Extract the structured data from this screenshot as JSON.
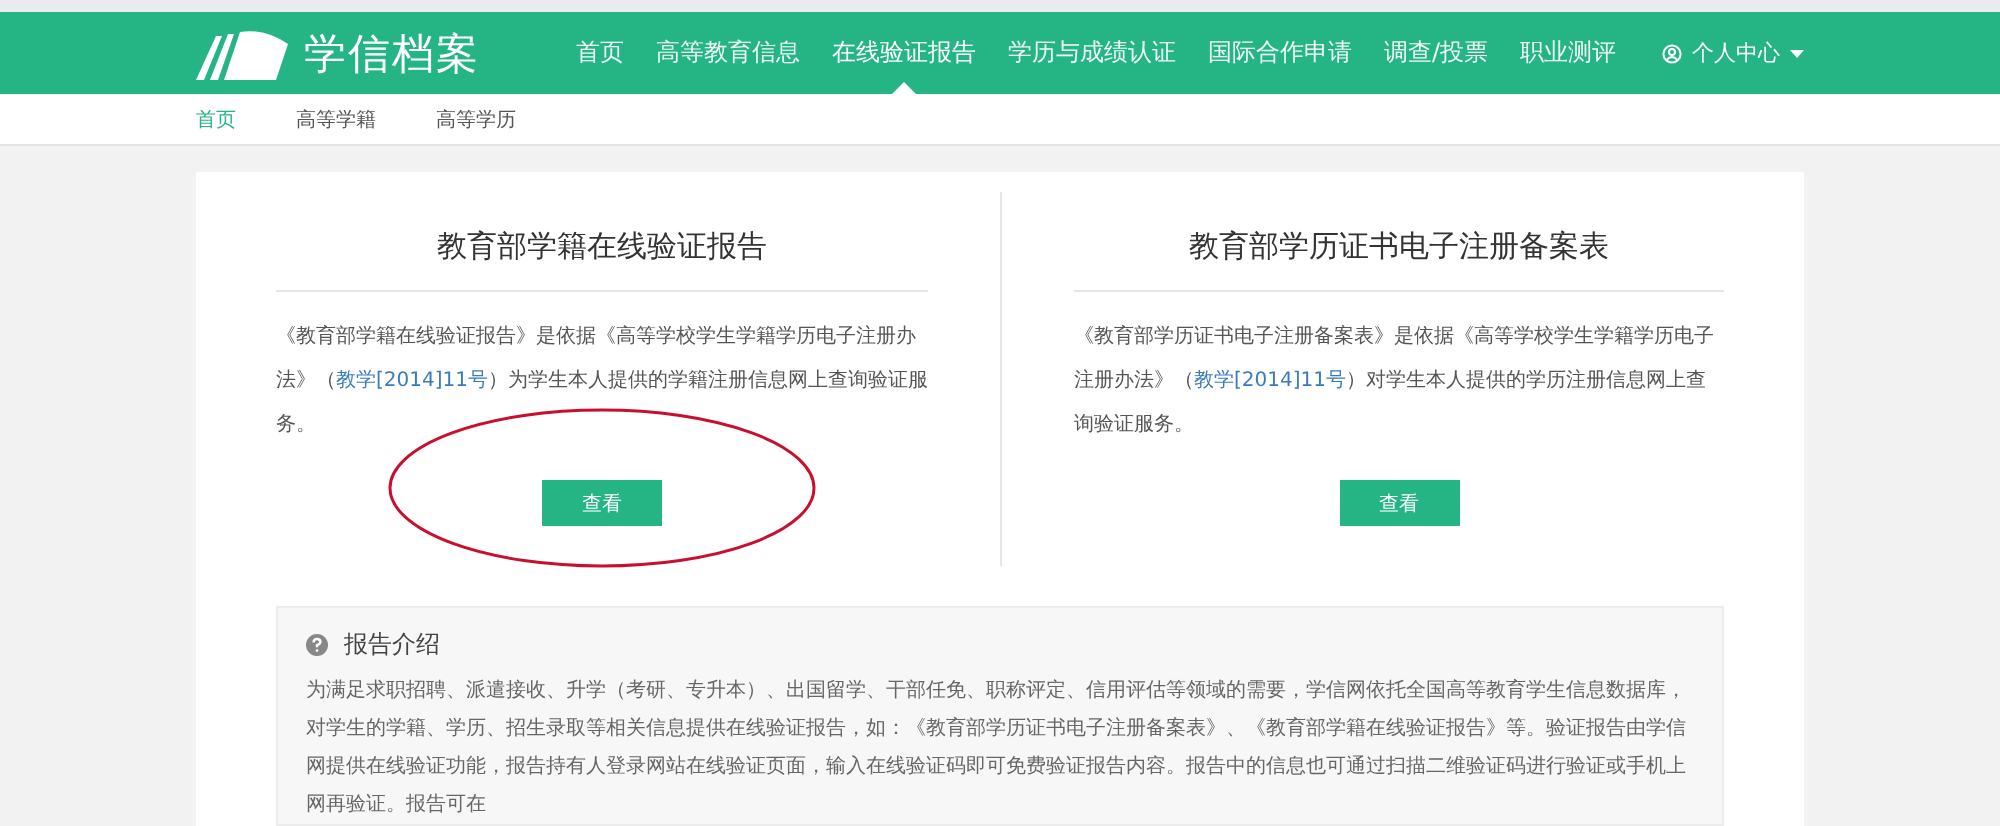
{
  "header": {
    "logo": "学信档案",
    "nav": [
      {
        "label": "首页",
        "selected": false
      },
      {
        "label": "高等教育信息",
        "selected": false
      },
      {
        "label": "在线验证报告",
        "selected": true
      },
      {
        "label": "学历与成绩认证",
        "selected": false
      },
      {
        "label": "国际合作申请",
        "selected": false
      },
      {
        "label": "调查/投票",
        "selected": false
      },
      {
        "label": "职业测评",
        "selected": false
      }
    ],
    "user_menu": "个人中心"
  },
  "subnav": [
    {
      "label": "首页",
      "selected": true
    },
    {
      "label": "高等学籍",
      "selected": false
    },
    {
      "label": "高等学历",
      "selected": false
    }
  ],
  "reports": [
    {
      "title": "教育部学籍在线验证报告",
      "before": "《教育部学籍在线验证报告》是依据《高等学校学生学籍学历电子注册办法》（",
      "link": "教学[2014]11号",
      "after": "）为学生本人提供的学籍注册信息网上查询验证服务。",
      "button": "查看",
      "circled": true
    },
    {
      "title": "教育部学历证书电子注册备案表",
      "before": "《教育部学历证书电子注册备案表》是依据《高等学校学生学籍学历电子注册办法》（",
      "link": "教学[2014]11号",
      "after": "）对学生本人提供的学历注册信息网上查询验证服务。",
      "button": "查看",
      "circled": false
    }
  ],
  "intro": {
    "title": "报告介绍",
    "text": "为满足求职招聘、派遣接收、升学（考研、专升本）、出国留学、干部任免、职称评定、信用评估等领域的需要，学信网依托全国高等教育学生信息数据库，对学生的学籍、学历、招生录取等相关信息提供在线验证报告，如：《教育部学历证书电子注册备案表》、《教育部学籍在线验证报告》等。验证报告由学信网提供在线验证功能，报告持有人登录网站在线验证页面，输入在线验证码即可免费验证报告内容。报告中的信息也可通过扫描二维验证码进行验证或手机上网再验证。报告可在"
  }
}
